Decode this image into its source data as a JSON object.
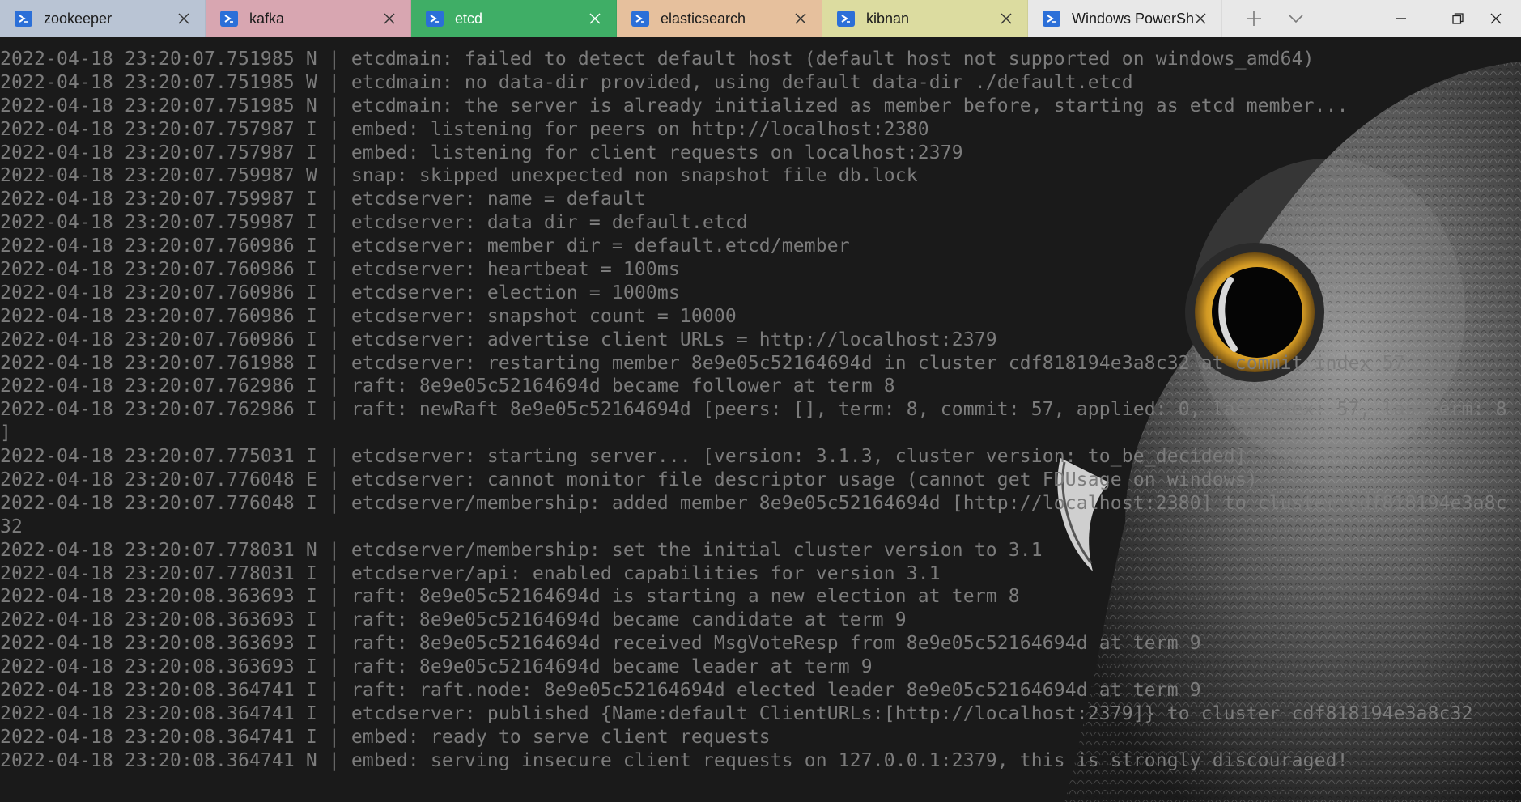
{
  "tabs": [
    {
      "label": "zookeeper",
      "color": "#b9c4d4",
      "width": 254,
      "active": false
    },
    {
      "label": "kafka",
      "color": "#d8a6b1",
      "width": 254,
      "active": false
    },
    {
      "label": "etcd",
      "color": "#3fae66",
      "width": 254,
      "active": true
    },
    {
      "label": "elasticsearch",
      "color": "#e6c09d",
      "width": 254,
      "active": false
    },
    {
      "label": "kibnan",
      "color": "#dcdca0",
      "width": 254,
      "active": false
    },
    {
      "label": "Windows PowerSh",
      "color": "#e8e8e8",
      "width": 240,
      "active": false
    }
  ],
  "tab_icon": "powershell-icon",
  "tabbar": {
    "new_tab_icon": "plus-icon",
    "dropdown_icon": "chevron-down-icon",
    "minimize_icon": "minimize-icon",
    "restore_icon": "restore-icon",
    "close_icon": "close-icon"
  },
  "terminal": {
    "text_color": "#7c7c7c",
    "lines": [
      "2022-04-18 23:20:07.751985 N | etcdmain: failed to detect default host (default host not supported on windows_amd64)",
      "2022-04-18 23:20:07.751985 W | etcdmain: no data-dir provided, using default data-dir ./default.etcd",
      "2022-04-18 23:20:07.751985 N | etcdmain: the server is already initialized as member before, starting as etcd member...",
      "2022-04-18 23:20:07.757987 I | embed: listening for peers on http://localhost:2380",
      "2022-04-18 23:20:07.757987 I | embed: listening for client requests on localhost:2379",
      "2022-04-18 23:20:07.759987 W | snap: skipped unexpected non snapshot file db.lock",
      "2022-04-18 23:20:07.759987 I | etcdserver: name = default",
      "2022-04-18 23:20:07.759987 I | etcdserver: data dir = default.etcd",
      "2022-04-18 23:20:07.760986 I | etcdserver: member dir = default.etcd/member",
      "2022-04-18 23:20:07.760986 I | etcdserver: heartbeat = 100ms",
      "2022-04-18 23:20:07.760986 I | etcdserver: election = 1000ms",
      "2022-04-18 23:20:07.760986 I | etcdserver: snapshot count = 10000",
      "2022-04-18 23:20:07.760986 I | etcdserver: advertise client URLs = http://localhost:2379",
      "2022-04-18 23:20:07.761988 I | etcdserver: restarting member 8e9e05c52164694d in cluster cdf818194e3a8c32 at commit index 57",
      "2022-04-18 23:20:07.762986 I | raft: 8e9e05c52164694d became follower at term 8",
      "2022-04-18 23:20:07.762986 I | raft: newRaft 8e9e05c52164694d [peers: [], term: 8, commit: 57, applied: 0, lastindex: 57, lastterm: 8",
      "]",
      "2022-04-18 23:20:07.775031 I | etcdserver: starting server... [version: 3.1.3, cluster version: to_be_decided]",
      "2022-04-18 23:20:07.776048 E | etcdserver: cannot monitor file descriptor usage (cannot get FDUsage on windows)",
      "2022-04-18 23:20:07.776048 I | etcdserver/membership: added member 8e9e05c52164694d [http://localhost:2380] to cluster cdf818194e3a8c",
      "32",
      "2022-04-18 23:20:07.778031 N | etcdserver/membership: set the initial cluster version to 3.1",
      "2022-04-18 23:20:07.778031 I | etcdserver/api: enabled capabilities for version 3.1",
      "2022-04-18 23:20:08.363693 I | raft: 8e9e05c52164694d is starting a new election at term 8",
      "2022-04-18 23:20:08.363693 I | raft: 8e9e05c52164694d became candidate at term 9",
      "2022-04-18 23:20:08.363693 I | raft: 8e9e05c52164694d received MsgVoteResp from 8e9e05c52164694d at term 9",
      "2022-04-18 23:20:08.363693 I | raft: 8e9e05c52164694d became leader at term 9",
      "2022-04-18 23:20:08.364741 I | raft: raft.node: 8e9e05c52164694d elected leader 8e9e05c52164694d at term 9",
      "2022-04-18 23:20:08.364741 I | etcdserver: published {Name:default ClientURLs:[http://localhost:2379]} to cluster cdf818194e3a8c32",
      "2022-04-18 23:20:08.364741 I | embed: ready to serve client requests",
      "2022-04-18 23:20:08.364741 N | embed: serving insecure client requests on 127.0.0.1:2379, this is strongly discouraged!"
    ]
  }
}
